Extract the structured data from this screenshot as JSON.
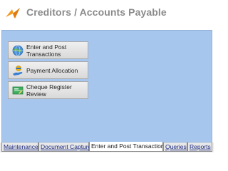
{
  "app": {
    "title": "Creditors / Accounts Payable"
  },
  "actions": [
    {
      "label_line1": "Enter and Post",
      "label_line2": "Transactions",
      "icon": "globe-icon"
    },
    {
      "label_line1": "Payment Allocation",
      "label_line2": "",
      "icon": "hand-coin-icon"
    },
    {
      "label_line1": "Cheque Register",
      "label_line2": "Review",
      "icon": "cheque-icon"
    }
  ],
  "tabs": [
    {
      "label": "Maintenance"
    },
    {
      "label": "Document Capture"
    },
    {
      "label": "Enter and Post Transactions",
      "active": true
    },
    {
      "label": "Queries"
    },
    {
      "label": "Reports"
    }
  ],
  "colors": {
    "panel": "#a7c6ee",
    "logo": "#f39a1e",
    "tab_text": "#1c2a80"
  }
}
